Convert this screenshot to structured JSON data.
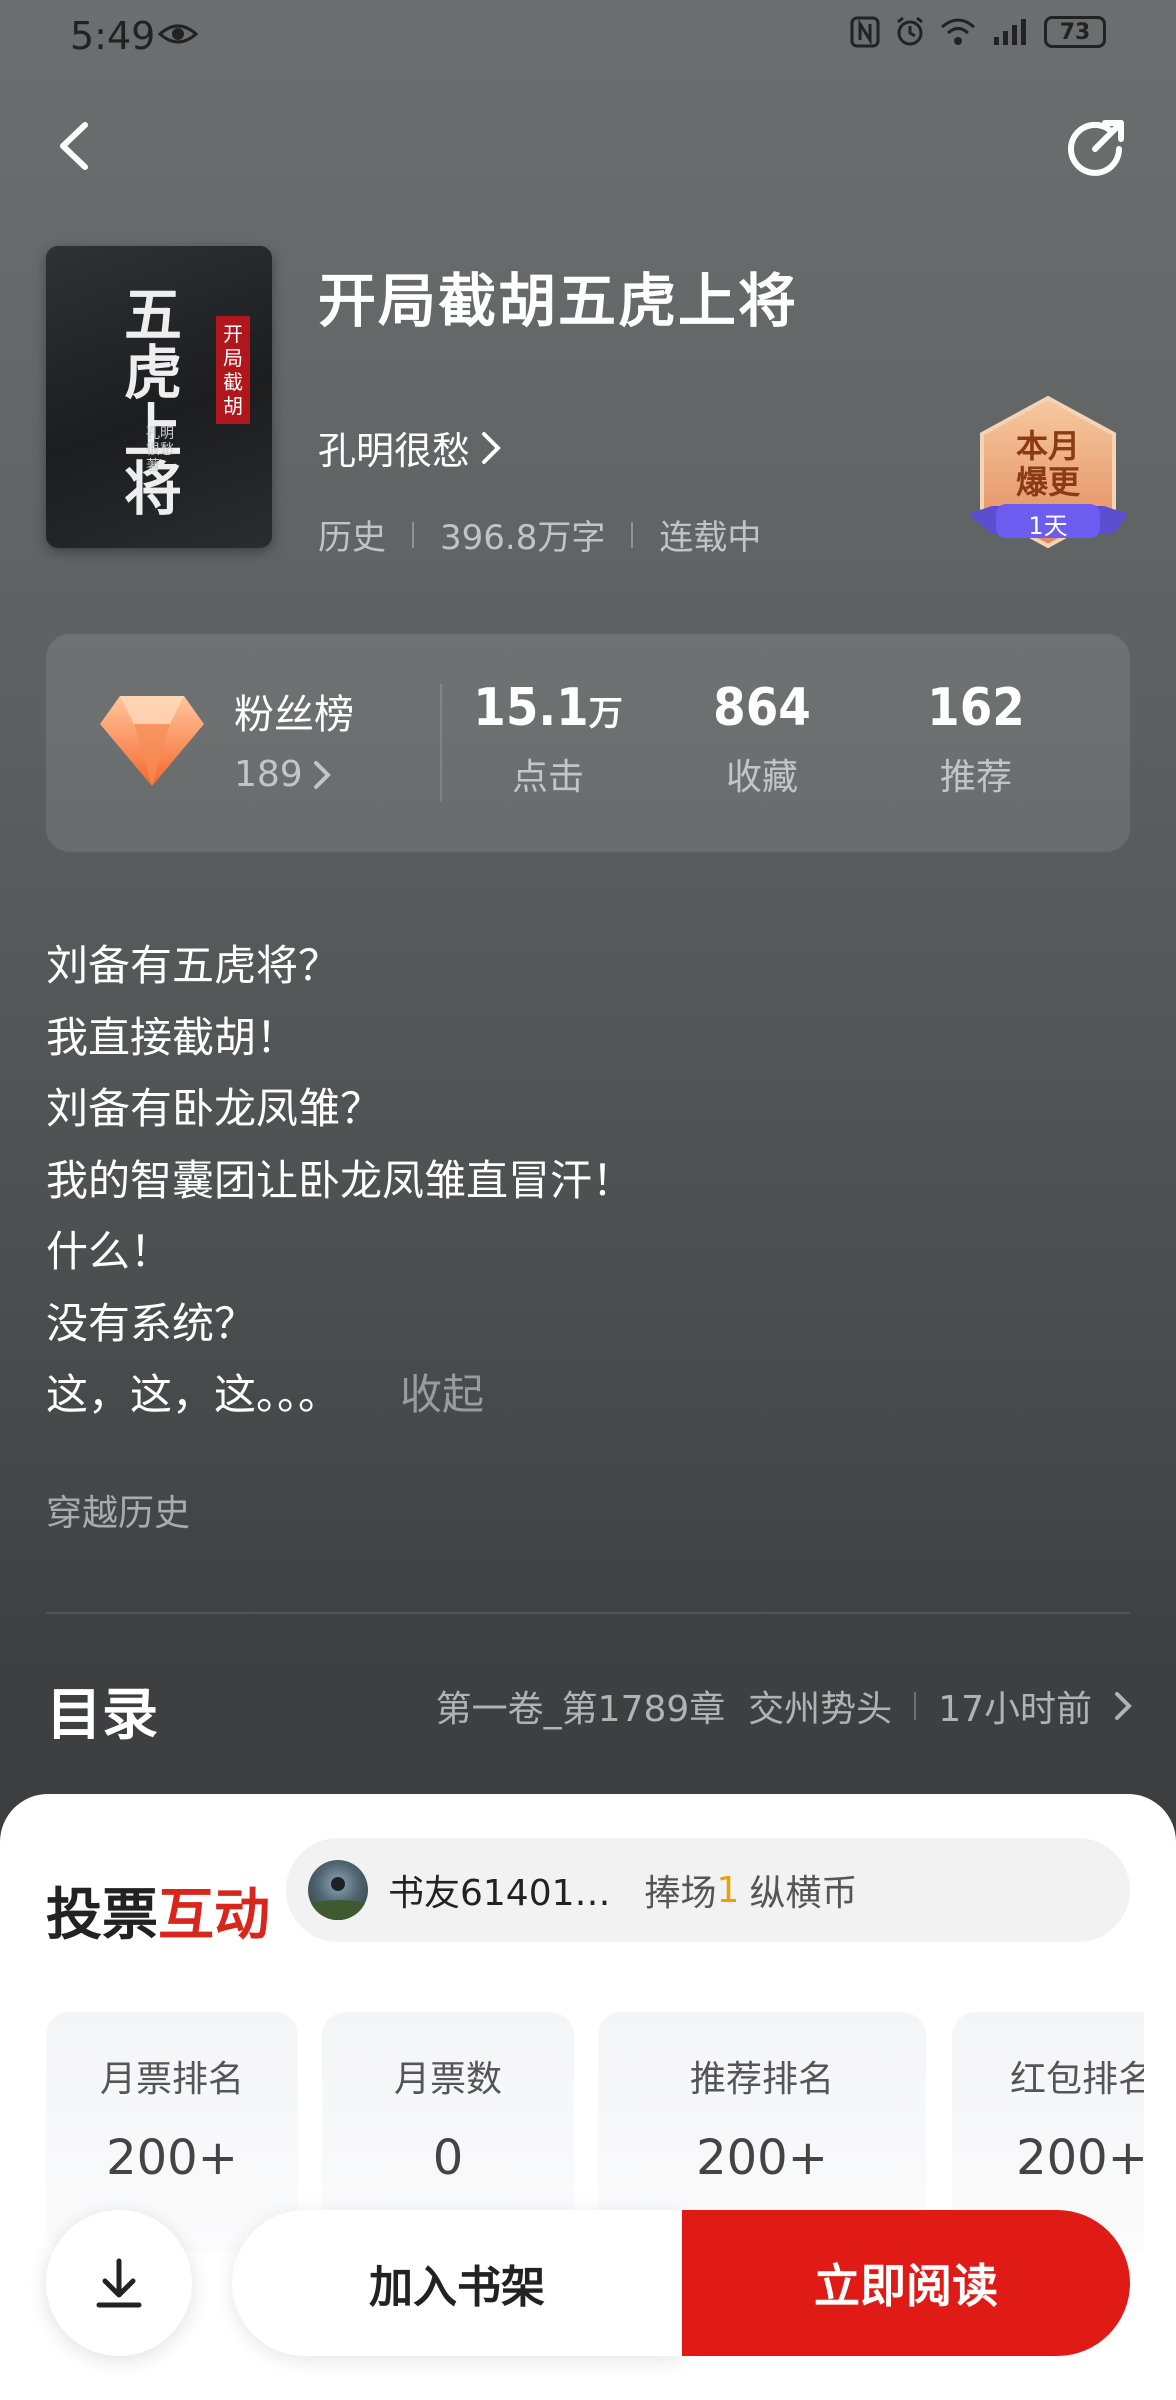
{
  "status_bar": {
    "time": "5:49",
    "battery": "73"
  },
  "book": {
    "title": "开局截胡五虎上将",
    "author": "孔明很愁",
    "category": "历史",
    "word_count": "396.8万字",
    "status": "连载中",
    "cover": {
      "big_text": "五虎上将",
      "ribbon_text": "开局截胡",
      "author_text": "孔明很愁 著"
    }
  },
  "badge": {
    "line1": "本月",
    "line2": "爆更",
    "days": "1天"
  },
  "stats": {
    "fan_rank_label": "粉丝榜",
    "fan_rank_count": "189",
    "clicks_value": "15.1",
    "clicks_unit": "万",
    "clicks_label": "点击",
    "favorites_value": "864",
    "favorites_label": "收藏",
    "recommend_value": "162",
    "recommend_label": "推荐"
  },
  "synopsis": {
    "lines": [
      "刘备有五虎将？",
      "我直接截胡！",
      "刘备有卧龙凤雏？",
      "我的智囊团让卧龙凤雏直冒汗！",
      "什么！",
      "没有系统？",
      "这，这，这。。。"
    ],
    "collapse_label": "收起"
  },
  "tag": "穿越历史",
  "toc": {
    "title": "目录",
    "latest_chapter": "第一卷_第1789章  交州势头",
    "updated": "17小时前"
  },
  "vote": {
    "title_part1": "投票",
    "title_part2": "互动",
    "user": "书友61401…",
    "action": "捧场",
    "amount": "1",
    "currency": "纵横币",
    "cards": [
      {
        "label": "月票排名",
        "value": "200+"
      },
      {
        "label": "月票数",
        "value": "0"
      },
      {
        "label": "推荐排名",
        "value": "200+"
      },
      {
        "label": "红包排名",
        "value": "200+"
      }
    ]
  },
  "actions": {
    "add_shelf": "加入书架",
    "read_now": "立即阅读"
  },
  "colors": {
    "accent_red": "#e01a14",
    "gold": "#e6a200"
  }
}
